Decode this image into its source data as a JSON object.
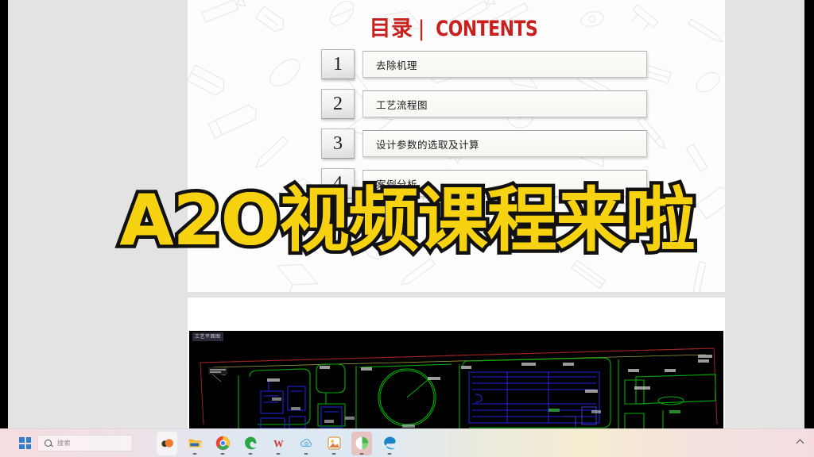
{
  "slide": {
    "title_cn": "目录",
    "title_divider": "|",
    "title_en": "CONTENTS",
    "title_color": "#c8201e",
    "toc": [
      {
        "num": "1",
        "label": "去除机理"
      },
      {
        "num": "2",
        "label": "工艺流程图"
      },
      {
        "num": "3",
        "label": "设计参数的选取及计算"
      },
      {
        "num": "4",
        "label": "案例分析"
      }
    ]
  },
  "cad": {
    "title_tag": "工艺平面图",
    "background": "#000000",
    "line_colors": [
      "#00b000",
      "#1b1bd8",
      "#a02020",
      "#b0b060"
    ]
  },
  "caption": {
    "text": "A2O视频课程来啦",
    "fill_color": "#f7d211",
    "stroke_color": "#111111"
  },
  "taskbar": {
    "start_label": "开始",
    "search_placeholder": "搜索",
    "apps": [
      {
        "name": "widgets-weather-icon",
        "state": "active"
      },
      {
        "name": "file-explorer-icon",
        "state": "running"
      },
      {
        "name": "chrome-icon",
        "state": "running"
      },
      {
        "name": "edge-legacy-icon",
        "state": "running"
      },
      {
        "name": "wps-office-icon",
        "state": "running"
      },
      {
        "name": "cloud-sync-icon",
        "state": "running"
      },
      {
        "name": "photos-icon",
        "state": "running"
      },
      {
        "name": "app-green-icon",
        "state": "highlighted"
      },
      {
        "name": "microsoft-edge-icon",
        "state": "running"
      }
    ],
    "tray_chevron": "show-hidden-icons"
  }
}
